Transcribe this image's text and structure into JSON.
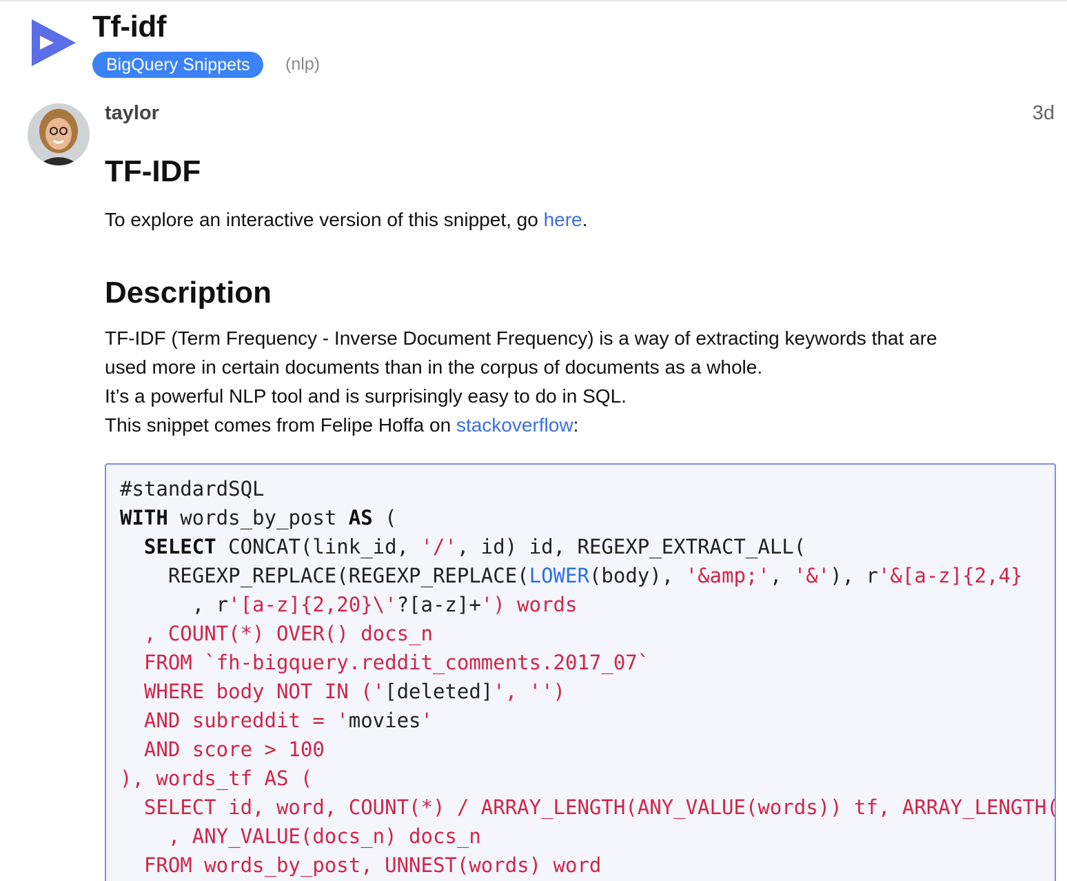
{
  "topic": {
    "title": "Tf-idf",
    "category": "BigQuery Snippets",
    "tag": "nlp"
  },
  "post": {
    "author": "taylor",
    "age": "3d",
    "heading": "TF-IDF",
    "intro_text": "To explore an interactive version of this snippet, go ",
    "intro_link": "here",
    "intro_end": ".",
    "description_heading": "Description",
    "description_line1": "TF-IDF (Term Frequency - Inverse Document Frequency) is a way of extracting keywords that are",
    "description_line2": "used more in certain documents than in the corpus of documents as a whole.",
    "description_line3": "It’s a powerful NLP tool and is surprisingly easy to do in SQL.",
    "description_line4_text": "This snippet comes from Felipe Hoffa on ",
    "description_line4_link": "stackoverflow",
    "description_line4_end": ":"
  },
  "code": {
    "l1": "#standardSQL",
    "l2a": "WITH",
    "l2b": " words_by_post ",
    "l2c": "AS",
    "l2d": " (",
    "l3a": "  ",
    "l3b": "SELECT",
    "l3c": " CONCAT(link_id, ",
    "l3d": "'/'",
    "l3e": ", id) id, REGEXP_EXTRACT_ALL(",
    "l4a": "    REGEXP_REPLACE(REGEXP_REPLACE(",
    "l4b": "LOWER",
    "l4c": "(body), ",
    "l4d": "'&amp;'",
    "l4e": ", ",
    "l4f": "'&'",
    "l4g": "), r",
    "l4h": "'&[a-z]{2,4}",
    "l5a": "      , r",
    "l5b": "'[a-z]{2,20}\\'",
    "l5c": "?[a-z]+",
    "l5d": "') words",
    "l6": "  , COUNT(*) OVER() docs_n",
    "l7": "  FROM `fh-bigquery.reddit_comments.2017_07`",
    "l8a": "  WHERE body NOT IN ('",
    "l8b": "[deleted]",
    "l8c": "', '')",
    "l9a": "  AND subreddit = '",
    "l9b": "movies",
    "l9c": "'",
    "l10": "  AND score > 100",
    "l11": "), words_tf AS (",
    "l12": "  SELECT id, word, COUNT(*) / ARRAY_LENGTH(ANY_VALUE(words)) tf, ARRAY_LENGTH(",
    "l13": "    , ANY_VALUE(docs_n) docs_n",
    "l14": "  FROM words_by_post, UNNEST(words) word"
  }
}
